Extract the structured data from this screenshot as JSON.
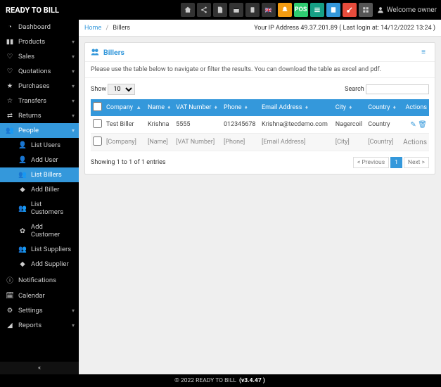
{
  "brand": "READY TO BILL",
  "topbar": {
    "pos_label": "POS",
    "welcome": "Welcome owner"
  },
  "crumbs": {
    "home": "Home",
    "current": "Billers"
  },
  "ip_line": "Your IP Address 49.37.201.89 ( Last login at: 14/12/2022 13:24 )",
  "panel": {
    "title": "Billers",
    "desc": "Please use the table below to navigate or filter the results. You can download the table as excel and pdf.",
    "show_label": "Show",
    "show_value": "10",
    "search_label": "Search"
  },
  "columns": [
    "Company",
    "Name",
    "VAT Number",
    "Phone",
    "Email Address",
    "City",
    "Country",
    "Actions"
  ],
  "rows": [
    {
      "company": "Test Biller",
      "name": "Krishna",
      "vat": "5555",
      "phone": "012345678",
      "email": "Krishna@tecdemo.com",
      "city": "Nagercoil",
      "country": "Country",
      "template": false,
      "actions_kind": "icons"
    },
    {
      "company": "[Company]",
      "name": "[Name]",
      "vat": "[VAT Number]",
      "phone": "[Phone]",
      "email": "[Email Address]",
      "city": "[City]",
      "country": "[Country]",
      "template": true,
      "actions_kind": "text",
      "actions_text": "Actions"
    }
  ],
  "info": "Showing 1 to 1 of 1 entries",
  "pager": {
    "prev": "< Previous",
    "page": "1",
    "next": "Next >"
  },
  "nav": {
    "dashboard": "Dashboard",
    "products": "Products",
    "sales": "Sales",
    "quotations": "Quotations",
    "purchases": "Purchases",
    "transfers": "Transfers",
    "returns": "Returns",
    "people": "People",
    "list_users": "List Users",
    "add_user": "Add User",
    "list_billers": "List Billers",
    "add_biller": "Add Biller",
    "list_customers": "List Customers",
    "add_customer": "Add Customer",
    "list_suppliers": "List Suppliers",
    "add_supplier": "Add Supplier",
    "notifications": "Notifications",
    "calendar": "Calendar",
    "settings": "Settings",
    "reports": "Reports"
  },
  "footer": {
    "copyright": "© 2022 READY TO BILL",
    "version": "(v3.4.47 )"
  }
}
